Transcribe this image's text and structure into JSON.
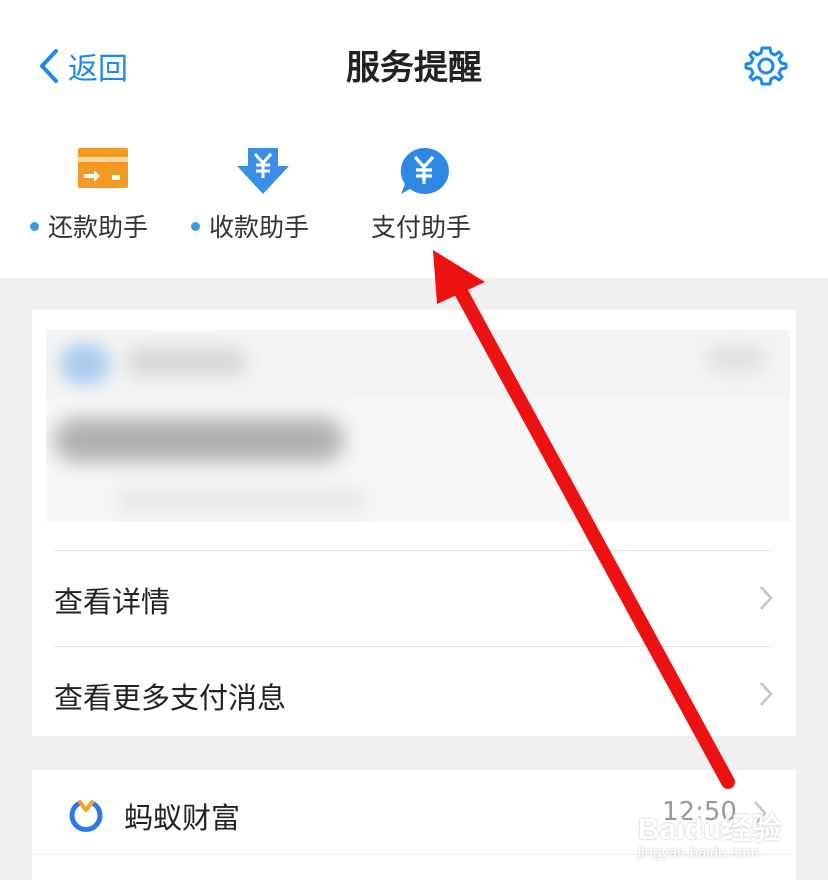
{
  "header": {
    "back_label": "返回",
    "title": "服务提醒"
  },
  "shortcuts": [
    {
      "label": "还款助手",
      "has_dot": true
    },
    {
      "label": "收款助手",
      "has_dot": true
    },
    {
      "label": "支付助手",
      "has_dot": false
    }
  ],
  "card": {
    "rows": [
      {
        "label": "查看详情"
      },
      {
        "label": "查看更多支付消息"
      }
    ]
  },
  "card2": {
    "name": "蚂蚁财富",
    "time": "12:50"
  },
  "watermark": {
    "brand": "Baidu经验",
    "url": "jingyan.baidu.com"
  },
  "colors": {
    "accent": "#1e8ae8",
    "arrow": "#ee1111",
    "orange": "#f59a23"
  }
}
